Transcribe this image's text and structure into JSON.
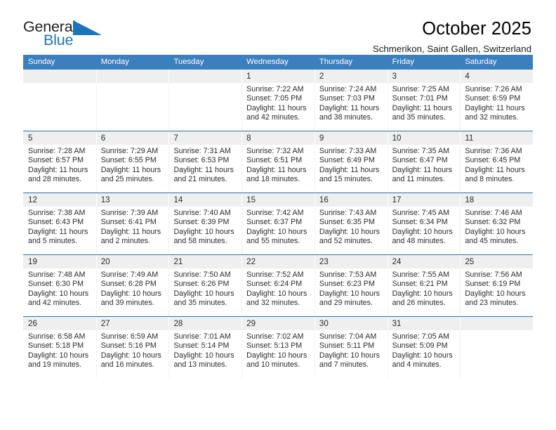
{
  "brand": {
    "word_one": "General",
    "word_two": "Blue",
    "triangle_icon": "triangle-icon",
    "color_dark": "#231f20",
    "color_blue": "#1b75bb"
  },
  "header": {
    "title": "October 2025",
    "subtitle": "Schmerikon, Saint Gallen, Switzerland"
  },
  "theme": {
    "header_row_bg": "#3b7fbe",
    "header_row_text": "#ffffff",
    "date_band_bg": "#efefef",
    "row_divider": "#2f6fa8",
    "cell_bg": "#ffffff",
    "text": "#2b2b2b"
  },
  "calendar": {
    "weekday_headers": [
      "Sunday",
      "Monday",
      "Tuesday",
      "Wednesday",
      "Thursday",
      "Friday",
      "Saturday"
    ],
    "labels": {
      "sunrise_prefix": "Sunrise:",
      "sunset_prefix": "Sunset:",
      "daylight_prefix": "Daylight:"
    },
    "weeks": [
      [
        {
          "day": "",
          "lines": []
        },
        {
          "day": "",
          "lines": []
        },
        {
          "day": "",
          "lines": []
        },
        {
          "day": "1",
          "lines": [
            "Sunrise: 7:22 AM",
            "Sunset: 7:05 PM",
            "Daylight: 11 hours",
            "and 42 minutes."
          ]
        },
        {
          "day": "2",
          "lines": [
            "Sunrise: 7:24 AM",
            "Sunset: 7:03 PM",
            "Daylight: 11 hours",
            "and 38 minutes."
          ]
        },
        {
          "day": "3",
          "lines": [
            "Sunrise: 7:25 AM",
            "Sunset: 7:01 PM",
            "Daylight: 11 hours",
            "and 35 minutes."
          ]
        },
        {
          "day": "4",
          "lines": [
            "Sunrise: 7:26 AM",
            "Sunset: 6:59 PM",
            "Daylight: 11 hours",
            "and 32 minutes."
          ]
        }
      ],
      [
        {
          "day": "5",
          "lines": [
            "Sunrise: 7:28 AM",
            "Sunset: 6:57 PM",
            "Daylight: 11 hours",
            "and 28 minutes."
          ]
        },
        {
          "day": "6",
          "lines": [
            "Sunrise: 7:29 AM",
            "Sunset: 6:55 PM",
            "Daylight: 11 hours",
            "and 25 minutes."
          ]
        },
        {
          "day": "7",
          "lines": [
            "Sunrise: 7:31 AM",
            "Sunset: 6:53 PM",
            "Daylight: 11 hours",
            "and 21 minutes."
          ]
        },
        {
          "day": "8",
          "lines": [
            "Sunrise: 7:32 AM",
            "Sunset: 6:51 PM",
            "Daylight: 11 hours",
            "and 18 minutes."
          ]
        },
        {
          "day": "9",
          "lines": [
            "Sunrise: 7:33 AM",
            "Sunset: 6:49 PM",
            "Daylight: 11 hours",
            "and 15 minutes."
          ]
        },
        {
          "day": "10",
          "lines": [
            "Sunrise: 7:35 AM",
            "Sunset: 6:47 PM",
            "Daylight: 11 hours",
            "and 11 minutes."
          ]
        },
        {
          "day": "11",
          "lines": [
            "Sunrise: 7:36 AM",
            "Sunset: 6:45 PM",
            "Daylight: 11 hours",
            "and 8 minutes."
          ]
        }
      ],
      [
        {
          "day": "12",
          "lines": [
            "Sunrise: 7:38 AM",
            "Sunset: 6:43 PM",
            "Daylight: 11 hours",
            "and 5 minutes."
          ]
        },
        {
          "day": "13",
          "lines": [
            "Sunrise: 7:39 AM",
            "Sunset: 6:41 PM",
            "Daylight: 11 hours",
            "and 2 minutes."
          ]
        },
        {
          "day": "14",
          "lines": [
            "Sunrise: 7:40 AM",
            "Sunset: 6:39 PM",
            "Daylight: 10 hours",
            "and 58 minutes."
          ]
        },
        {
          "day": "15",
          "lines": [
            "Sunrise: 7:42 AM",
            "Sunset: 6:37 PM",
            "Daylight: 10 hours",
            "and 55 minutes."
          ]
        },
        {
          "day": "16",
          "lines": [
            "Sunrise: 7:43 AM",
            "Sunset: 6:35 PM",
            "Daylight: 10 hours",
            "and 52 minutes."
          ]
        },
        {
          "day": "17",
          "lines": [
            "Sunrise: 7:45 AM",
            "Sunset: 6:34 PM",
            "Daylight: 10 hours",
            "and 48 minutes."
          ]
        },
        {
          "day": "18",
          "lines": [
            "Sunrise: 7:46 AM",
            "Sunset: 6:32 PM",
            "Daylight: 10 hours",
            "and 45 minutes."
          ]
        }
      ],
      [
        {
          "day": "19",
          "lines": [
            "Sunrise: 7:48 AM",
            "Sunset: 6:30 PM",
            "Daylight: 10 hours",
            "and 42 minutes."
          ]
        },
        {
          "day": "20",
          "lines": [
            "Sunrise: 7:49 AM",
            "Sunset: 6:28 PM",
            "Daylight: 10 hours",
            "and 39 minutes."
          ]
        },
        {
          "day": "21",
          "lines": [
            "Sunrise: 7:50 AM",
            "Sunset: 6:26 PM",
            "Daylight: 10 hours",
            "and 35 minutes."
          ]
        },
        {
          "day": "22",
          "lines": [
            "Sunrise: 7:52 AM",
            "Sunset: 6:24 PM",
            "Daylight: 10 hours",
            "and 32 minutes."
          ]
        },
        {
          "day": "23",
          "lines": [
            "Sunrise: 7:53 AM",
            "Sunset: 6:23 PM",
            "Daylight: 10 hours",
            "and 29 minutes."
          ]
        },
        {
          "day": "24",
          "lines": [
            "Sunrise: 7:55 AM",
            "Sunset: 6:21 PM",
            "Daylight: 10 hours",
            "and 26 minutes."
          ]
        },
        {
          "day": "25",
          "lines": [
            "Sunrise: 7:56 AM",
            "Sunset: 6:19 PM",
            "Daylight: 10 hours",
            "and 23 minutes."
          ]
        }
      ],
      [
        {
          "day": "26",
          "lines": [
            "Sunrise: 6:58 AM",
            "Sunset: 5:18 PM",
            "Daylight: 10 hours",
            "and 19 minutes."
          ]
        },
        {
          "day": "27",
          "lines": [
            "Sunrise: 6:59 AM",
            "Sunset: 5:16 PM",
            "Daylight: 10 hours",
            "and 16 minutes."
          ]
        },
        {
          "day": "28",
          "lines": [
            "Sunrise: 7:01 AM",
            "Sunset: 5:14 PM",
            "Daylight: 10 hours",
            "and 13 minutes."
          ]
        },
        {
          "day": "29",
          "lines": [
            "Sunrise: 7:02 AM",
            "Sunset: 5:13 PM",
            "Daylight: 10 hours",
            "and 10 minutes."
          ]
        },
        {
          "day": "30",
          "lines": [
            "Sunrise: 7:04 AM",
            "Sunset: 5:11 PM",
            "Daylight: 10 hours",
            "and 7 minutes."
          ]
        },
        {
          "day": "31",
          "lines": [
            "Sunrise: 7:05 AM",
            "Sunset: 5:09 PM",
            "Daylight: 10 hours",
            "and 4 minutes."
          ]
        },
        {
          "day": "",
          "lines": []
        }
      ]
    ]
  }
}
